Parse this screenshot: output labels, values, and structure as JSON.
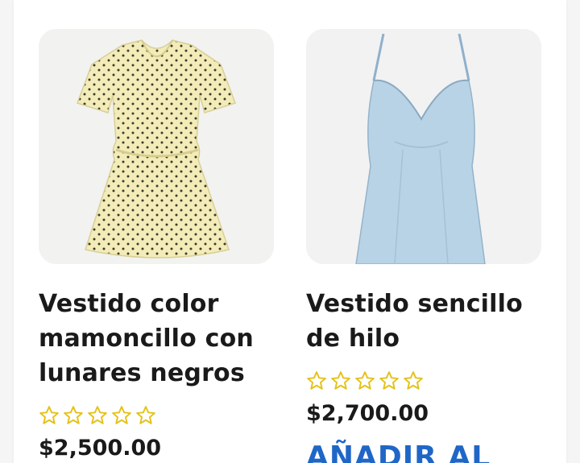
{
  "products": [
    {
      "title": "Vestido color mamoncillo con lunares negros",
      "rating_stars": 5,
      "rating_value": 0,
      "price": "$2,500.00",
      "image_icon": "yellow-polka-dot-dress-image"
    },
    {
      "title": "Vestido sencillo de hilo",
      "rating_stars": 5,
      "rating_value": 0,
      "price": "$2,700.00",
      "add_to_cart_label": "AÑADIR AL",
      "image_icon": "light-blue-slip-dress-image"
    }
  ],
  "colors": {
    "star_outline": "#e4c21a",
    "title_text": "#1a1a1a",
    "cta_text": "#1f66c7"
  }
}
